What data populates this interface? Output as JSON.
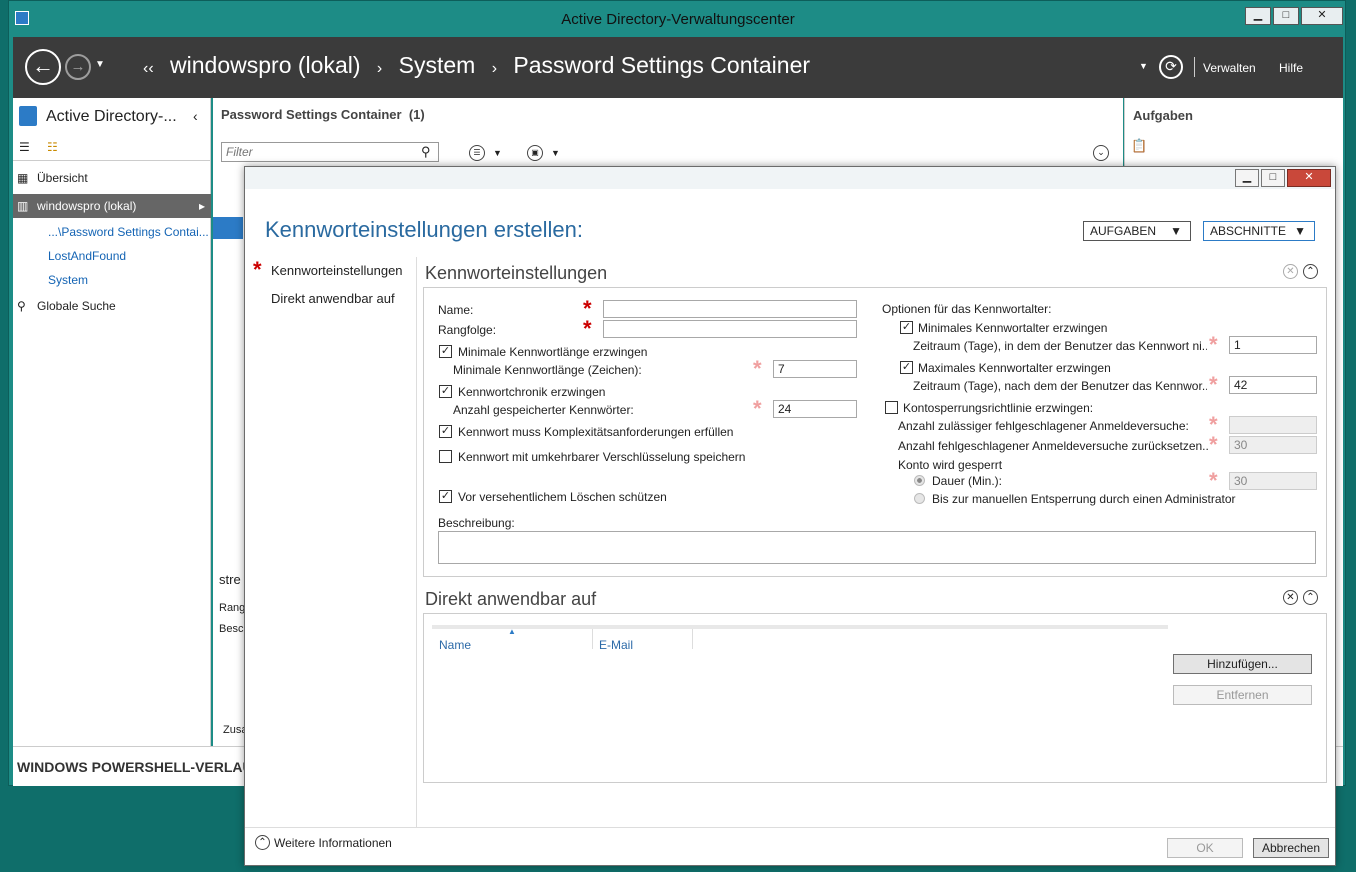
{
  "window": {
    "title": "Active Directory-Verwaltungscenter",
    "minimize": "▁",
    "maximize": "□",
    "close": "✕"
  },
  "nav": {
    "back": "←",
    "forward": "→",
    "breadcrumb": [
      "windowspro (lokal)",
      "System",
      "Password Settings Container"
    ],
    "crumb_prefix": "‹‹",
    "crumb_sep": "›",
    "refresh": "⟳",
    "manage": "Verwalten",
    "help": "Hilfe"
  },
  "left": {
    "title": "Active Directory-...",
    "items": [
      {
        "label": "Übersicht"
      },
      {
        "label": "windowspro (lokal)"
      },
      {
        "label": "...\\Password Settings Contai..."
      },
      {
        "label": "LostAndFound"
      },
      {
        "label": "System"
      },
      {
        "label": "Globale Suche"
      }
    ]
  },
  "center": {
    "title": "Password Settings Container  (1)",
    "filter_placeholder": "Filter",
    "peek1": "stre",
    "peek2": "Rang",
    "peek3": "Besc",
    "peek4": "Zusa"
  },
  "right": {
    "title": "Aufgaben"
  },
  "powershell": {
    "label": "WINDOWS POWERSHELL-VERLAUF"
  },
  "dialog": {
    "heading": "Kennworteinstellungen erstellen:",
    "tasks_btn": "AUFGABEN",
    "sections_btn": "ABSCHNITTE",
    "nav": [
      "Kennworteinstellungen",
      "Direkt anwendbar auf"
    ],
    "more_info": "Weitere Informationen",
    "ok": "OK",
    "cancel": "Abbrechen",
    "pw_section": {
      "title": "Kennworteinstellungen",
      "name_label": "Name:",
      "name_value": "",
      "rank_label": "Rangfolge:",
      "rank_value": "",
      "min_len_check": "Minimale Kennwortlänge erzwingen",
      "min_len_label": "Minimale Kennwortlänge (Zeichen):",
      "min_len_value": "7",
      "history_check": "Kennwortchronik erzwingen",
      "history_label": "Anzahl gespeicherter Kennwörter:",
      "history_value": "24",
      "complexity_check": "Kennwort muss Komplexitätsanforderungen erfüllen",
      "reversible_check": "Kennwort mit umkehrbarer Verschlüsselung speichern",
      "protect_check": "Vor versehentlichem Löschen schützen",
      "desc_label": "Beschreibung:",
      "desc_value": "",
      "age_title": "Optionen für das Kennwortalter:",
      "min_age_check": "Minimales Kennwortalter erzwingen",
      "min_age_label": "Zeitraum (Tage), in dem der Benutzer das Kennwort ni...",
      "min_age_value": "1",
      "max_age_check": "Maximales Kennwortalter erzwingen",
      "max_age_label": "Zeitraum (Tage), nach dem der Benutzer das Kennwor...",
      "max_age_value": "42",
      "lockout_check": "Kontosperrungsrichtlinie erzwingen:",
      "lockout_attempts_label": "Anzahl zulässiger fehlgeschlagener Anmeldeversuche:",
      "lockout_attempts_value": "",
      "lockout_reset_label": "Anzahl fehlgeschlagener Anmeldeversuche zurücksetzen...",
      "lockout_reset_value": "30",
      "locked_label": "Konto wird gesperrt",
      "duration_label": "Dauer (Min.):",
      "duration_value": "30",
      "manual_label": "Bis zur manuellen Entsperrung durch einen Administrator"
    },
    "apply_section": {
      "title": "Direkt anwendbar auf",
      "col_name": "Name",
      "col_email": "E-Mail",
      "add": "Hinzufügen...",
      "remove": "Entfernen"
    }
  }
}
